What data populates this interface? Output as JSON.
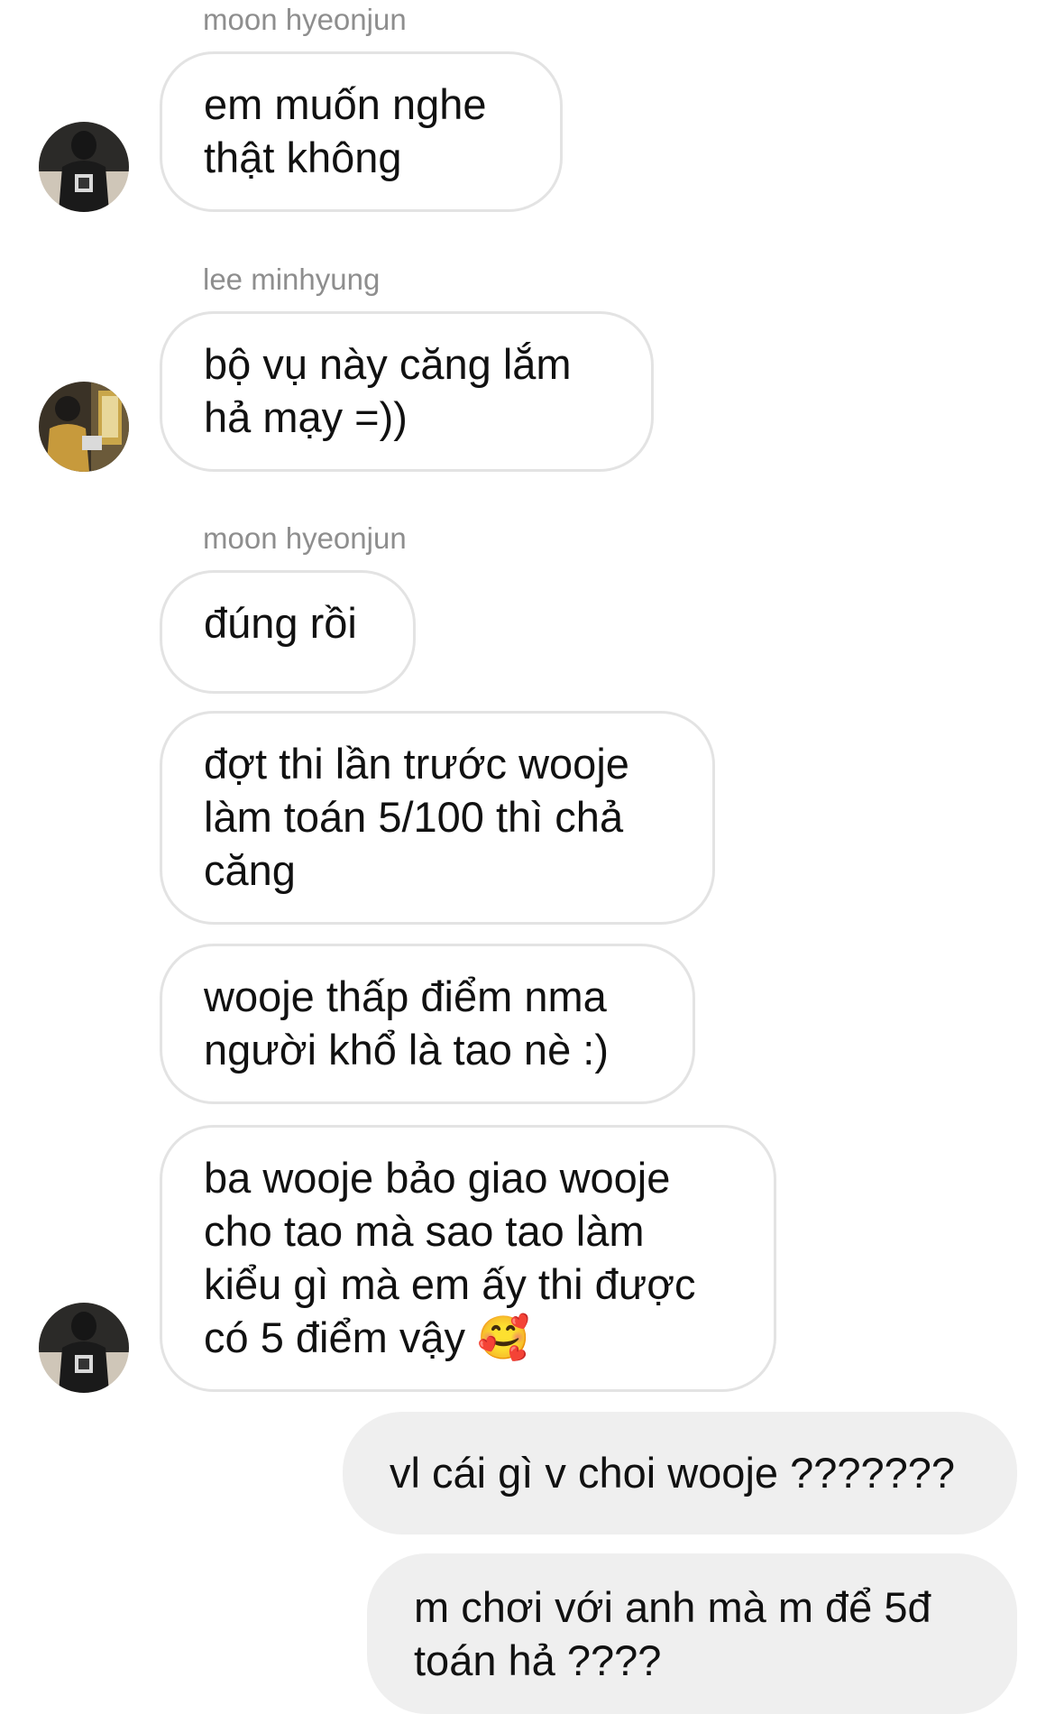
{
  "messages": [
    {
      "sender": "moon hyeonjun",
      "text": "em muốn nghe\nthật không"
    },
    {
      "sender": "lee minhyung",
      "text": "bộ vụ này căng lắm\nhả mạy =))"
    },
    {
      "sender": "moon hyeonjun",
      "text": "đúng rồi"
    },
    {
      "text": "đợt thi lần trước wooje\nlàm toán 5/100 thì chả\ncăng"
    },
    {
      "text": "wooje thấp điểm nma\nngười khổ là tao nè :)"
    },
    {
      "text": "ba wooje bảo giao wooje\ncho tao mà sao tao làm\nkiểu gì mà em ấy thi được\ncó 5 điểm vậy 🥰"
    }
  ],
  "outgoing": [
    {
      "text": "vl cái gì v choi wooje ???????"
    },
    {
      "text": "m chơi với anh mà m để 5đ\ntoán hả ????"
    }
  ],
  "avatars": [
    "avatar-moon-hyeonjun",
    "avatar-lee-minhyung"
  ],
  "colors": {
    "incoming_border": "#e3e3e3",
    "outgoing_bg": "#efefef",
    "sender_name": "#8e8e8e"
  }
}
